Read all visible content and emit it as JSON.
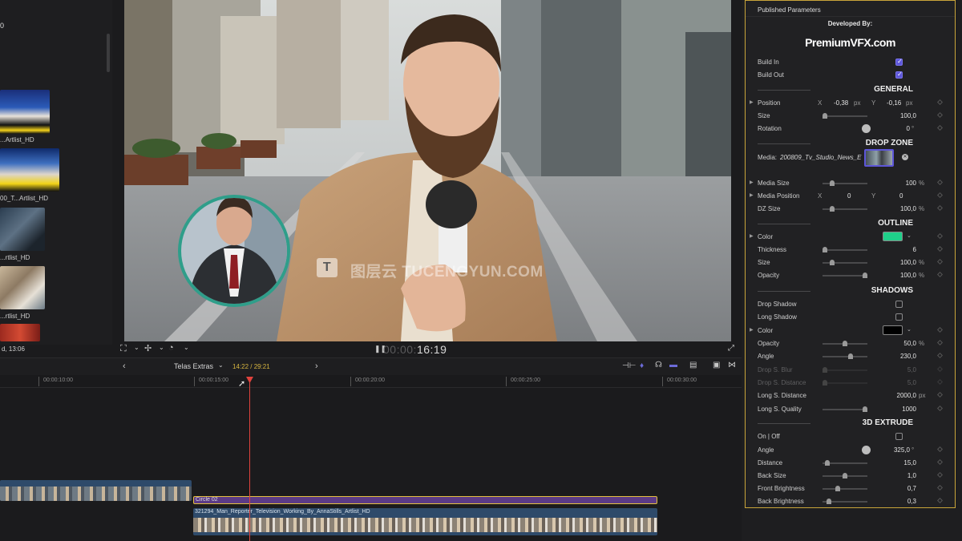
{
  "browser": {
    "top_number": "0",
    "clips": [
      {
        "caption": "...Artlist_HD"
      },
      {
        "caption": "00_T...Artlist_HD"
      },
      {
        "caption": "...rtlist_HD"
      },
      {
        "caption": "...rtlist_HD"
      },
      {
        "caption": ""
      }
    ],
    "footer": "d, 13:06"
  },
  "viewer": {
    "timecode_dim": "00:00:",
    "timecode_bright": "16:19",
    "watermark": "TUCENGYUN.COM",
    "watermark_prefix": "图层云",
    "watermark_logo": "T"
  },
  "timeline": {
    "project_name": "Telas Extras",
    "position": "14:22 / 29:21",
    "ruler": [
      "00:00:10:00",
      "00:00:15:00",
      "00:00:20:00",
      "00:00:25:00",
      "00:00:30:00"
    ],
    "title_clip": "Circle 02",
    "main_clip": "321294_Man_Reporter_Television_Working_By_AnnaStills_Artlist_HD"
  },
  "inspector": {
    "title": "Published Parameters",
    "developed_by": "Developed By:",
    "logo": "PremiumVFX.com",
    "build_in": "Build In",
    "build_out": "Build Out",
    "sections": {
      "general": "GENERAL",
      "drop_zone": "DROP ZONE",
      "outline": "OUTLINE",
      "shadows": "SHADOWS",
      "extrude": "3D EXTRUDE"
    },
    "position": {
      "label": "Position",
      "x_label": "X",
      "x": "-0,38",
      "x_unit": "px",
      "y_label": "Y",
      "y": "-0,16",
      "y_unit": "px"
    },
    "size": {
      "label": "Size",
      "value": "100,0"
    },
    "rotation": {
      "label": "Rotation",
      "value": "0",
      "unit": "°"
    },
    "media": {
      "label": "Media:",
      "file": "200809_Tv_Studio_News_E"
    },
    "media_size": {
      "label": "Media Size",
      "value": "100",
      "unit": "%"
    },
    "media_position": {
      "label": "Media Position",
      "x_label": "X",
      "x": "0",
      "y_label": "Y",
      "y": "0"
    },
    "dz_size": {
      "label": "DZ Size",
      "value": "100,0",
      "unit": "%"
    },
    "outline_color": {
      "label": "Color",
      "swatch": "#1fd08a"
    },
    "thickness": {
      "label": "Thickness",
      "value": "6"
    },
    "outline_size": {
      "label": "Size",
      "value": "100,0",
      "unit": "%"
    },
    "outline_opacity": {
      "label": "Opacity",
      "value": "100,0",
      "unit": "%"
    },
    "drop_shadow": {
      "label": "Drop Shadow"
    },
    "long_shadow": {
      "label": "Long Shadow"
    },
    "shadow_color": {
      "label": "Color",
      "swatch": "#000000"
    },
    "shadow_opacity": {
      "label": "Opacity",
      "value": "50,0",
      "unit": "%"
    },
    "shadow_angle": {
      "label": "Angle",
      "value": "230,0"
    },
    "drop_blur": {
      "label": "Drop S. Blur",
      "value": "5,0"
    },
    "drop_distance": {
      "label": "Drop S. Distance",
      "value": "5,0"
    },
    "long_distance": {
      "label": "Long S. Distance",
      "value": "2000,0",
      "unit": "px"
    },
    "long_quality": {
      "label": "Long S. Quality",
      "value": "1000"
    },
    "on_off": {
      "label": "On | Off"
    },
    "extrude_angle": {
      "label": "Angle",
      "value": "325,0",
      "unit": "°"
    },
    "distance": {
      "label": "Distance",
      "value": "15,0"
    },
    "back_size": {
      "label": "Back Size",
      "value": "1,0"
    },
    "front_brightness": {
      "label": "Front Brightness",
      "value": "0,7"
    },
    "back_brightness": {
      "label": "Back Brightness",
      "value": "0,3"
    },
    "checkbox_states": {
      "build_in": true,
      "build_out": true,
      "drop_shadow": false,
      "long_shadow": false,
      "on_off": false
    }
  }
}
